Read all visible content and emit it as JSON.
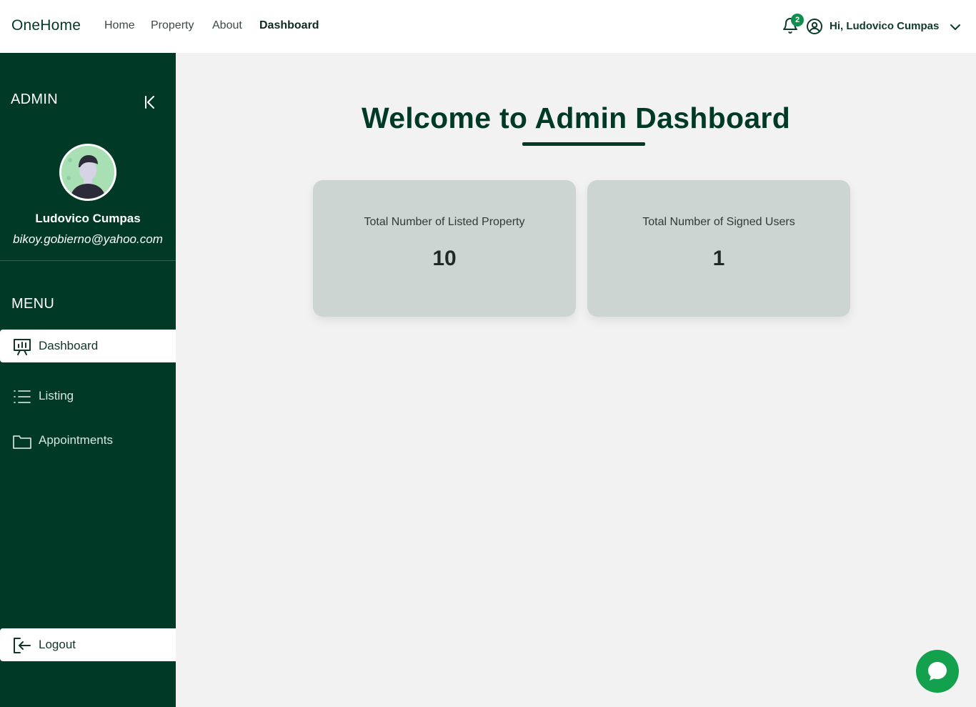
{
  "navbar": {
    "brand": "OneHome",
    "links": [
      "Home",
      "Property",
      "About",
      "Dashboard"
    ],
    "active_link": "Dashboard",
    "notification_count": "2",
    "greeting": "Hi, Ludovico Cumpas"
  },
  "sidebar": {
    "title": "ADMIN",
    "profile": {
      "name": "Ludovico Cumpas",
      "email": "bikoy.gobierno@yahoo.com"
    },
    "menu_title": "MENU",
    "items": [
      {
        "label": "Dashboard",
        "icon": "presentation-chart-icon",
        "active": true
      },
      {
        "label": "Listing",
        "icon": "list-icon",
        "active": false
      },
      {
        "label": "Appointments",
        "icon": "folder-icon",
        "active": false
      }
    ],
    "logout_label": "Logout"
  },
  "main": {
    "welcome": "Welcome to Admin Dashboard",
    "cards": [
      {
        "label": "Total Number of Listed Property",
        "value": "10"
      },
      {
        "label": "Total Number of Signed Users",
        "value": "1"
      }
    ]
  },
  "colors": {
    "primary": "#003a27",
    "accent": "#13a14e",
    "card_bg": "#ccd5d2",
    "page_bg": "#f2f2f2"
  }
}
